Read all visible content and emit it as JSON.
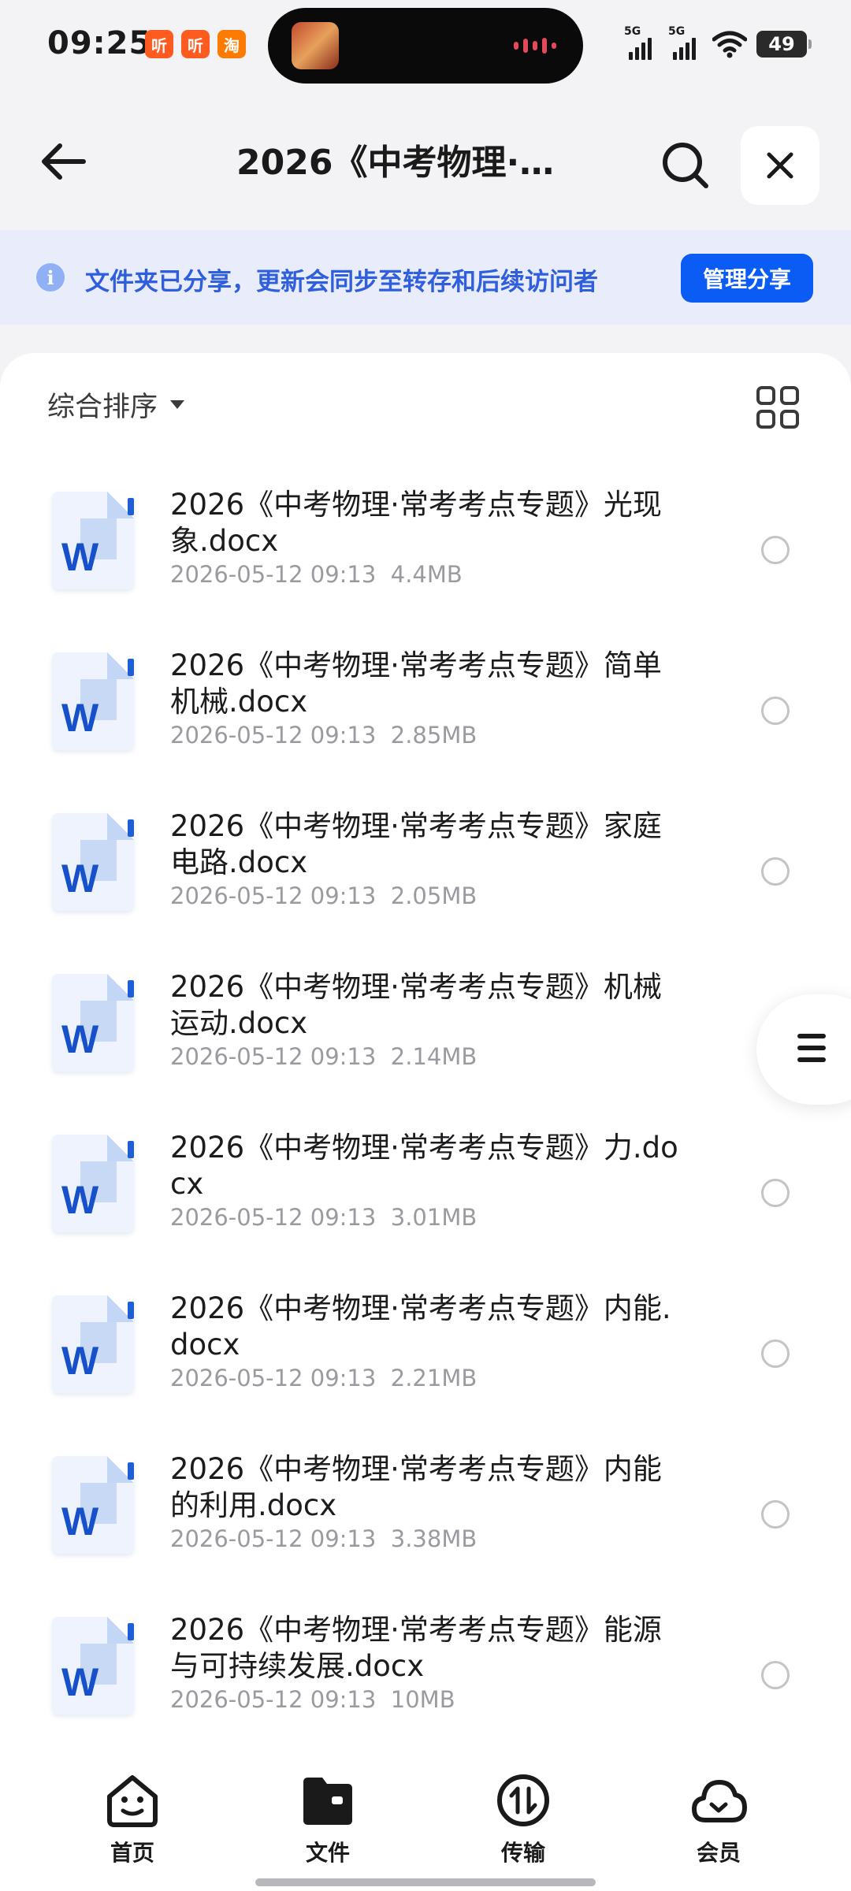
{
  "status_bar": {
    "time": "09:25",
    "notifications": [
      {
        "icon": "tingting-app-icon",
        "text": "听"
      },
      {
        "icon": "tingting-app-icon",
        "text": "听"
      },
      {
        "icon": "taobao-app-icon",
        "text": "淘"
      }
    ],
    "signal_labels": [
      "5G",
      "5G"
    ],
    "battery": "49"
  },
  "header": {
    "title": "2026《中考物理·…",
    "back_icon": "back-arrow-icon",
    "search_icon": "search-icon",
    "close_icon": "close-icon"
  },
  "banner": {
    "info_icon": "info-icon",
    "text": "文件夹已分享，更新会同步至转存和后续访问者",
    "manage_button": "管理分享"
  },
  "toolbar": {
    "sort_label": "综合排序",
    "view_toggle_icon": "grid-view-icon"
  },
  "files": [
    {
      "name": "2026《中考物理·常考考点专题》光现象.docx",
      "date": "2026-05-12 09:13",
      "size": "4.4MB"
    },
    {
      "name": "2026《中考物理·常考考点专题》简单机械.docx",
      "date": "2026-05-12 09:13",
      "size": "2.85MB"
    },
    {
      "name": "2026《中考物理·常考考点专题》家庭电路.docx",
      "date": "2026-05-12 09:13",
      "size": "2.05MB"
    },
    {
      "name": "2026《中考物理·常考考点专题》机械运动.docx",
      "date": "2026-05-12 09:13",
      "size": "2.14MB"
    },
    {
      "name": "2026《中考物理·常考考点专题》力.docx",
      "date": "2026-05-12 09:13",
      "size": "3.01MB"
    },
    {
      "name": "2026《中考物理·常考考点专题》内能.docx",
      "date": "2026-05-12 09:13",
      "size": "2.21MB"
    },
    {
      "name": "2026《中考物理·常考考点专题》内能的利用.docx",
      "date": "2026-05-12 09:13",
      "size": "3.38MB"
    },
    {
      "name": "2026《中考物理·常考考点专题》能源与可持续发展.docx",
      "date": "2026-05-12 09:13",
      "size": "10MB"
    }
  ],
  "file_icon": "word-doc-icon",
  "float_menu_icon": "menu-lines-icon",
  "bottom_nav": [
    {
      "label": "首页",
      "icon": "home-smile-icon"
    },
    {
      "label": "文件",
      "icon": "folder-icon"
    },
    {
      "label": "传输",
      "icon": "transfer-icon"
    },
    {
      "label": "会员",
      "icon": "cloud-icon"
    }
  ],
  "colors": {
    "accent": "#0a5cf5",
    "banner_bg": "#e9edfb",
    "banner_text": "#2f5fdc",
    "word_blue": "#1751c9"
  }
}
